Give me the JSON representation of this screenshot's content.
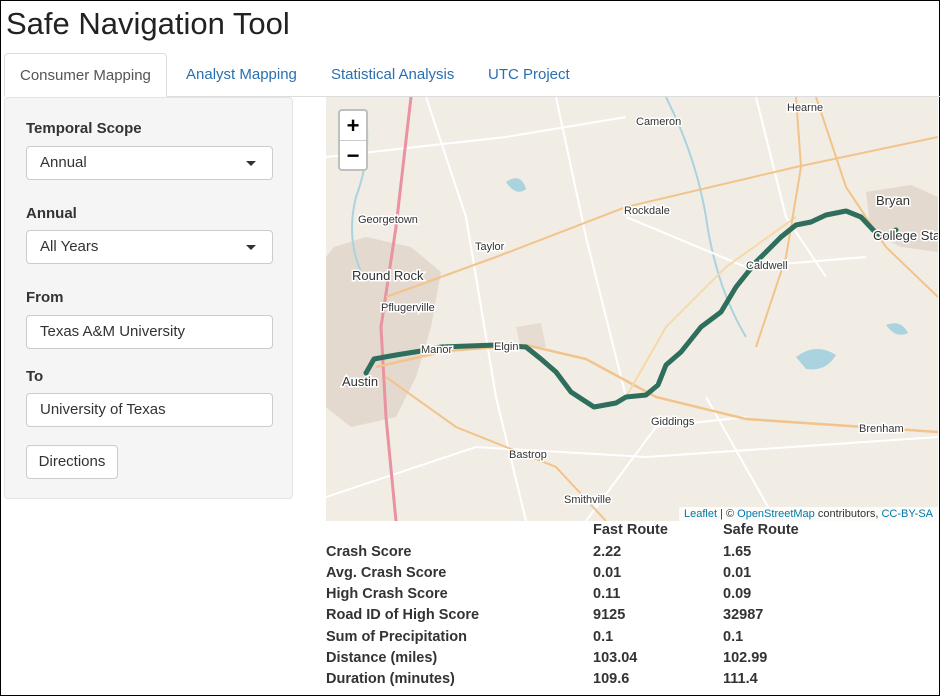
{
  "app": {
    "title": "Safe Navigation Tool"
  },
  "tabs": [
    {
      "label": "Consumer Mapping",
      "active": true
    },
    {
      "label": "Analyst Mapping",
      "active": false
    },
    {
      "label": "Statistical Analysis",
      "active": false
    },
    {
      "label": "UTC Project",
      "active": false
    }
  ],
  "sidebar": {
    "temporal_scope": {
      "label": "Temporal Scope",
      "value": "Annual"
    },
    "annual": {
      "label": "Annual",
      "value": "All Years"
    },
    "from": {
      "label": "From",
      "value": "Texas A&M University"
    },
    "to": {
      "label": "To",
      "value": "University of Texas"
    },
    "directions_button": "Directions"
  },
  "map": {
    "zoom_in": "+",
    "zoom_out": "−",
    "places": [
      "Hearne",
      "Cameron",
      "Bryan",
      "College Sta",
      "Georgetown",
      "Rockdale",
      "Taylor",
      "Round Rock",
      "Pflugerville",
      "Caldwell",
      "Manor",
      "Elgin",
      "Austin",
      "Giddings",
      "Brenham",
      "Bastrop",
      "Smithville"
    ],
    "attribution": {
      "leaflet": "Leaflet",
      "sep": " | © ",
      "osm": "OpenStreetMap",
      "contrib": " contributors, ",
      "license": "CC-BY-SA"
    },
    "route_color": "#2f6e5d"
  },
  "results": {
    "headers": [
      "",
      "Fast Route",
      "Safe Route"
    ],
    "rows": [
      [
        "Crash Score",
        "2.22",
        "1.65"
      ],
      [
        "Avg. Crash Score",
        "0.01",
        "0.01"
      ],
      [
        "High Crash Score",
        "0.11",
        "0.09"
      ],
      [
        "Road ID of High Score",
        "9125",
        "32987"
      ],
      [
        "Sum of Precipitation",
        "0.1",
        "0.1"
      ],
      [
        "Distance (miles)",
        "103.04",
        "102.99"
      ],
      [
        "Duration (minutes)",
        "109.6",
        "111.4"
      ]
    ]
  }
}
